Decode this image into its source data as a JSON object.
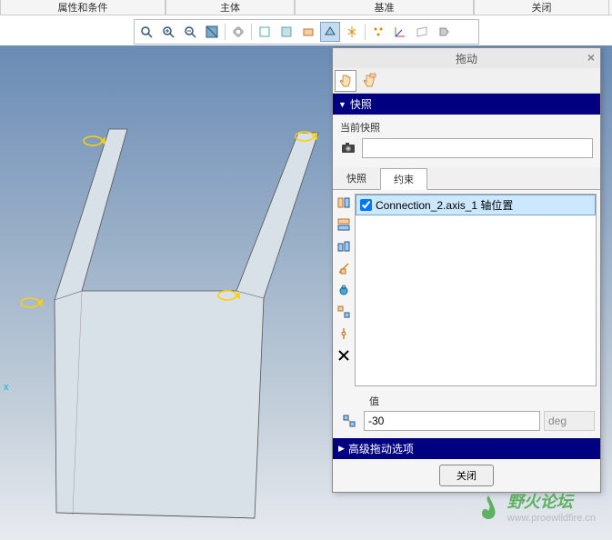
{
  "ribbon": {
    "tabs": [
      "属性和条件",
      "主体",
      "基准",
      "关闭"
    ]
  },
  "toolbar": {
    "icons": [
      "zoom-fit-icon",
      "zoom-in-icon",
      "zoom-out-icon",
      "zoom-window-icon",
      "spin-icon",
      "display-style-icon",
      "datum-display-icon",
      "annotation-icon",
      "render-icon",
      "axis-display-icon",
      "point-display-icon",
      "csys-display-icon",
      "plane-display-icon",
      "model-tree-icon"
    ]
  },
  "viewport": {
    "label_x": "x"
  },
  "dialog": {
    "title": "拖动",
    "hand_tools": [
      "drag-hand-icon",
      "drag-select-icon"
    ],
    "snapshot": {
      "header": "快照",
      "label": "当前快照",
      "value": ""
    },
    "tabs": [
      "快照",
      "约束"
    ],
    "active_tab": 1,
    "constraint_tools": [
      "align-icon",
      "mate-icon",
      "orient-icon",
      "motion-axis-icon",
      "body-lock-icon",
      "enable-disable-icon",
      "ground-icon",
      "delete-constraint-icon"
    ],
    "constraints": [
      {
        "checked": true,
        "label": "Connection_2.axis_1 轴位置"
      }
    ],
    "value_section": {
      "label": "值",
      "value": "-30",
      "unit": "deg"
    },
    "advanced_header": "高级拖动选项",
    "close_btn": "关闭"
  },
  "watermark": {
    "text": "野火论坛",
    "url": "www.proewildfire.cn"
  }
}
